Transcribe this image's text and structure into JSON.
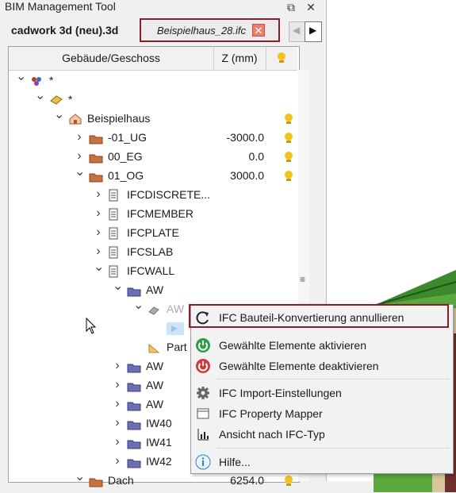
{
  "window": {
    "title": "BIM Management Tool",
    "pin_glyph": "⧉",
    "close_glyph": "✕"
  },
  "tabs": [
    {
      "label": "cadwork 3d (neu).3d",
      "active": true
    },
    {
      "label": "Beispielhaus_28.ifc",
      "close": "✕"
    }
  ],
  "nav": {
    "left": "◀",
    "right": "▶"
  },
  "tree": {
    "headers": {
      "name": "Gebäude/Geschoss",
      "z": "Z (mm)"
    },
    "rows": [
      {
        "label": "*",
        "icon": "project-icon"
      },
      {
        "label": "*",
        "icon": "site-icon"
      },
      {
        "label": "Beispielhaus",
        "icon": "building-icon"
      },
      {
        "label": "-01_UG",
        "z": "-3000.0",
        "icon": "storey-icon"
      },
      {
        "label": "00_EG",
        "z": "0.0",
        "icon": "storey-icon"
      },
      {
        "label": "01_OG",
        "z": "3000.0",
        "icon": "storey-icon"
      },
      {
        "label": "IFCDISCRETE...",
        "icon": "ifc-type-icon"
      },
      {
        "label": "IFCMEMBER",
        "icon": "ifc-type-icon"
      },
      {
        "label": "IFCPLATE",
        "icon": "ifc-type-icon"
      },
      {
        "label": "IFCSLAB",
        "icon": "ifc-type-icon"
      },
      {
        "label": "IFCWALL",
        "icon": "ifc-type-icon"
      },
      {
        "label": "AW",
        "icon": "element-group-icon"
      },
      {
        "label": "AW",
        "icon": "element-icon"
      },
      {
        "label": "",
        "icon": "part-icon"
      },
      {
        "label": "Part",
        "icon": "part-icon"
      },
      {
        "label": "AW",
        "icon": "element-group-icon"
      },
      {
        "label": "AW",
        "icon": "element-group-icon"
      },
      {
        "label": "AW",
        "icon": "element-group-icon"
      },
      {
        "label": "IW40",
        "icon": "element-group-icon"
      },
      {
        "label": "IW41",
        "icon": "element-group-icon"
      },
      {
        "label": "IW42",
        "icon": "element-group-icon"
      },
      {
        "label": "Dach",
        "z": "6254.0",
        "icon": "storey-icon"
      }
    ],
    "scroll_glyph": "≡"
  },
  "context_menu": {
    "items": [
      {
        "label": "IFC Bauteil-Konvertierung annullieren",
        "icon": "undo-icon"
      },
      {
        "label": "Gewählte Elemente aktivieren",
        "icon": "power-on-icon"
      },
      {
        "label": "Gewählte Elemente deaktivieren",
        "icon": "power-off-icon"
      },
      {
        "label": "IFC Import-Einstellungen",
        "icon": "gear-icon"
      },
      {
        "label": "IFC Property Mapper",
        "icon": "window-icon"
      },
      {
        "label": "Ansicht nach IFC-Typ",
        "icon": "chart-icon"
      },
      {
        "label": "Hilfe...",
        "icon": "info-icon"
      }
    ]
  },
  "colors": {
    "highlight_border": "#8a1e2a",
    "bulb": "#f4c21a",
    "storey_folder": "#c9713d",
    "green_model": "#5aa83e"
  }
}
